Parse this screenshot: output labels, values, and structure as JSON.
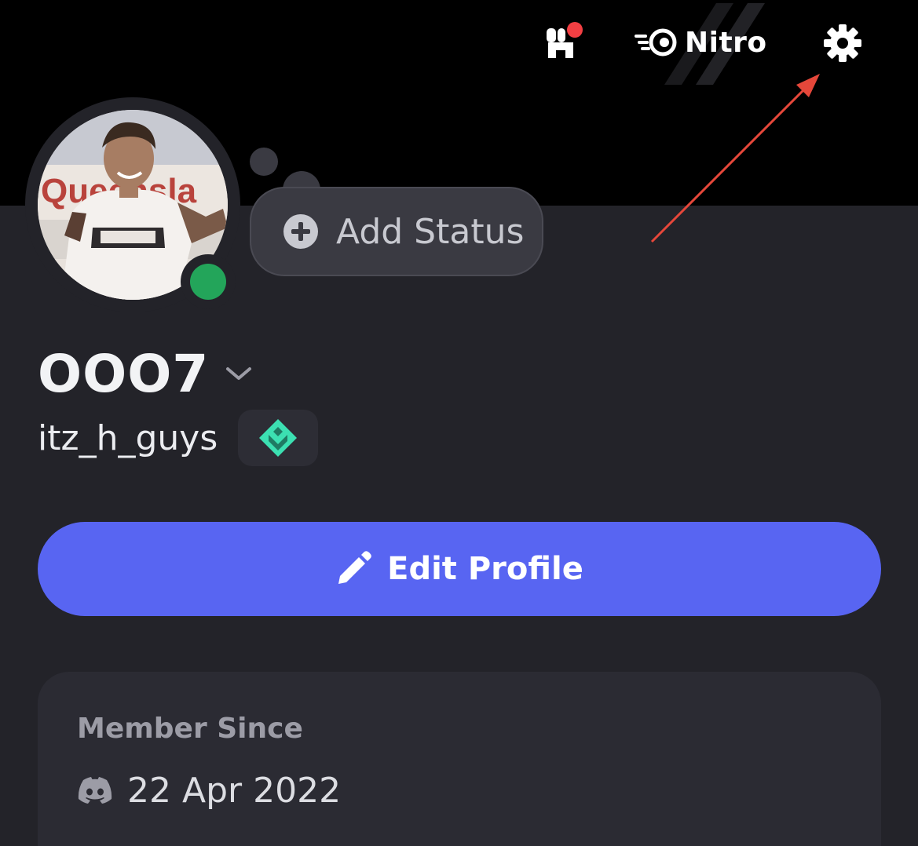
{
  "header": {
    "nitro_label": "Nitro"
  },
  "status": {
    "add_status_label": "Add Status",
    "presence": "online",
    "presence_color": "#23a55a"
  },
  "profile": {
    "display_name": "OOO7",
    "username": "itz_h_guys"
  },
  "actions": {
    "edit_profile_label": "Edit Profile"
  },
  "member_since": {
    "title": "Member Since",
    "date": "22 Apr 2022"
  },
  "colors": {
    "accent": "#5865f2",
    "notification": "#f23f43",
    "annotation_arrow": "#e5473a",
    "badge": "#3ce0b2"
  },
  "icons": {
    "shop": "shop-icon",
    "nitro": "nitro-icon",
    "settings": "gear-icon",
    "add": "plus-circle-icon",
    "edit": "pencil-icon",
    "badge": "quest-badge-icon",
    "member": "discord-icon",
    "dropdown": "chevron-down-icon"
  }
}
